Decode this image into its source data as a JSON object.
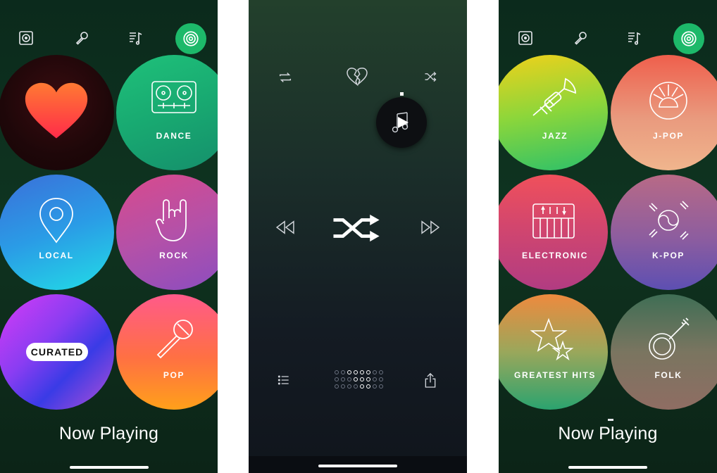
{
  "screens": [
    {
      "top_icons": [
        "speaker-icon",
        "microphone-icon",
        "music-list-icon",
        "radio-icon"
      ],
      "genres": [
        {
          "label": "",
          "icon": "heart-icon"
        },
        {
          "label": "DANCE",
          "icon": "turntable-icon"
        },
        {
          "label": "LOCAL",
          "icon": "location-pin-icon"
        },
        {
          "label": "ROCK",
          "icon": "rock-hand-icon"
        },
        {
          "label": "CURATED",
          "icon": ""
        },
        {
          "label": "POP",
          "icon": "microphone-icon"
        }
      ],
      "now_playing": "Now Playing"
    },
    {
      "controls": [
        "repeat-icon",
        "broken-heart-icon",
        "shuffle-small-icon",
        "rewind-icon",
        "shuffle-large-icon",
        "fast-forward-icon",
        "list-icon",
        "share-icon"
      ]
    },
    {
      "top_icons": [
        "speaker-icon",
        "microphone-icon",
        "music-list-icon",
        "radio-icon"
      ],
      "genres": [
        {
          "label": "JAZZ",
          "icon": "trumpet-icon"
        },
        {
          "label": "J-POP",
          "icon": "rising-sun-icon"
        },
        {
          "label": "ELECTRONIC",
          "icon": "keyboard-icon"
        },
        {
          "label": "K-POP",
          "icon": "taegeuk-icon"
        },
        {
          "label": "GREATEST HITS",
          "icon": "stars-icon"
        },
        {
          "label": "FOLK",
          "icon": "banjo-icon"
        }
      ],
      "now_playing": "Now Playing"
    }
  ]
}
